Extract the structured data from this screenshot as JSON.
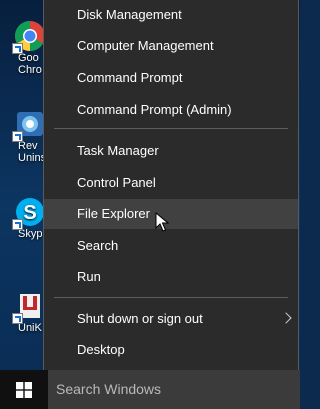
{
  "desktop": {
    "icons": [
      {
        "label": "Goo\nChro",
        "name": "google-chrome"
      },
      {
        "label": "Rev\nUninst",
        "name": "revo-uninstaller"
      },
      {
        "label": "Skyp",
        "name": "skype"
      },
      {
        "label": "UniK",
        "name": "unikey"
      }
    ]
  },
  "menu": {
    "items": [
      {
        "label": "Disk Management"
      },
      {
        "label": "Computer Management"
      },
      {
        "label": "Command Prompt"
      },
      {
        "label": "Command Prompt (Admin)"
      },
      {
        "label": "Task Manager"
      },
      {
        "label": "Control Panel"
      },
      {
        "label": "File Explorer"
      },
      {
        "label": "Search"
      },
      {
        "label": "Run"
      },
      {
        "label": "Shut down or sign out"
      },
      {
        "label": "Desktop"
      }
    ],
    "hovered": "File Explorer"
  },
  "taskbar": {
    "search_placeholder": "Search Windows",
    "start_icon": "windows-logo-icon"
  },
  "colors": {
    "menu_bg": "#2b2b2b",
    "hover_bg": "#414141",
    "taskbar_bg": "#101010",
    "search_bg": "#3b3b3b",
    "desktop_bg": "#0c3561"
  }
}
